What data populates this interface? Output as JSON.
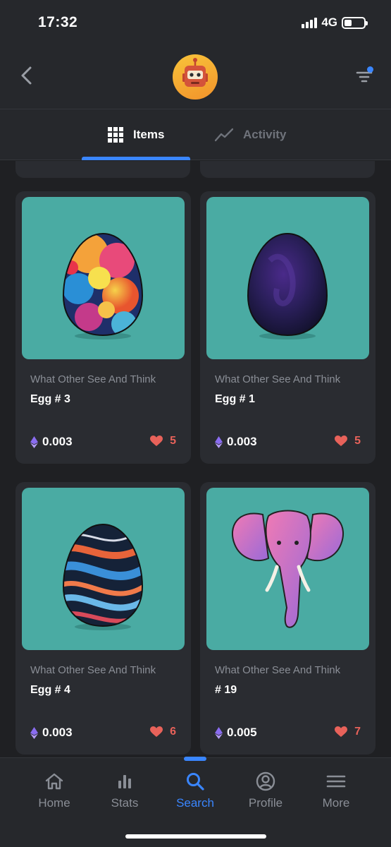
{
  "status": {
    "time": "17:32",
    "network": "4G"
  },
  "tabs": [
    {
      "label": "Items",
      "active": true,
      "icon": "grid-icon"
    },
    {
      "label": "Activity",
      "active": false,
      "icon": "trend-line-icon"
    }
  ],
  "cards": [
    {
      "collection": "What Other See And Think",
      "title": "Egg # 3",
      "price": "0.003",
      "likes": "5",
      "image": "egg-rainbow-smoke"
    },
    {
      "collection": "What Other See And Think",
      "title": "Egg # 1",
      "price": "0.003",
      "likes": "5",
      "image": "egg-dark-purple"
    },
    {
      "collection": "What Other See And Think",
      "title": "Egg # 4",
      "price": "0.003",
      "likes": "6",
      "image": "egg-marble-waves"
    },
    {
      "collection": "What Other See And Think",
      "title": "# 19",
      "price": "0.005",
      "likes": "7",
      "image": "pink-elephant"
    }
  ],
  "nav": [
    {
      "label": "Home",
      "icon": "home-icon",
      "active": false
    },
    {
      "label": "Stats",
      "icon": "stats-icon",
      "active": false
    },
    {
      "label": "Search",
      "icon": "search-icon",
      "active": true
    },
    {
      "label": "Profile",
      "icon": "profile-icon",
      "active": false
    },
    {
      "label": "More",
      "icon": "menu-icon",
      "active": false
    }
  ],
  "colors": {
    "accent": "#3a86ff",
    "like": "#e8625a",
    "card_bg": "#2a2c31",
    "image_bg": "#4aaba3"
  }
}
